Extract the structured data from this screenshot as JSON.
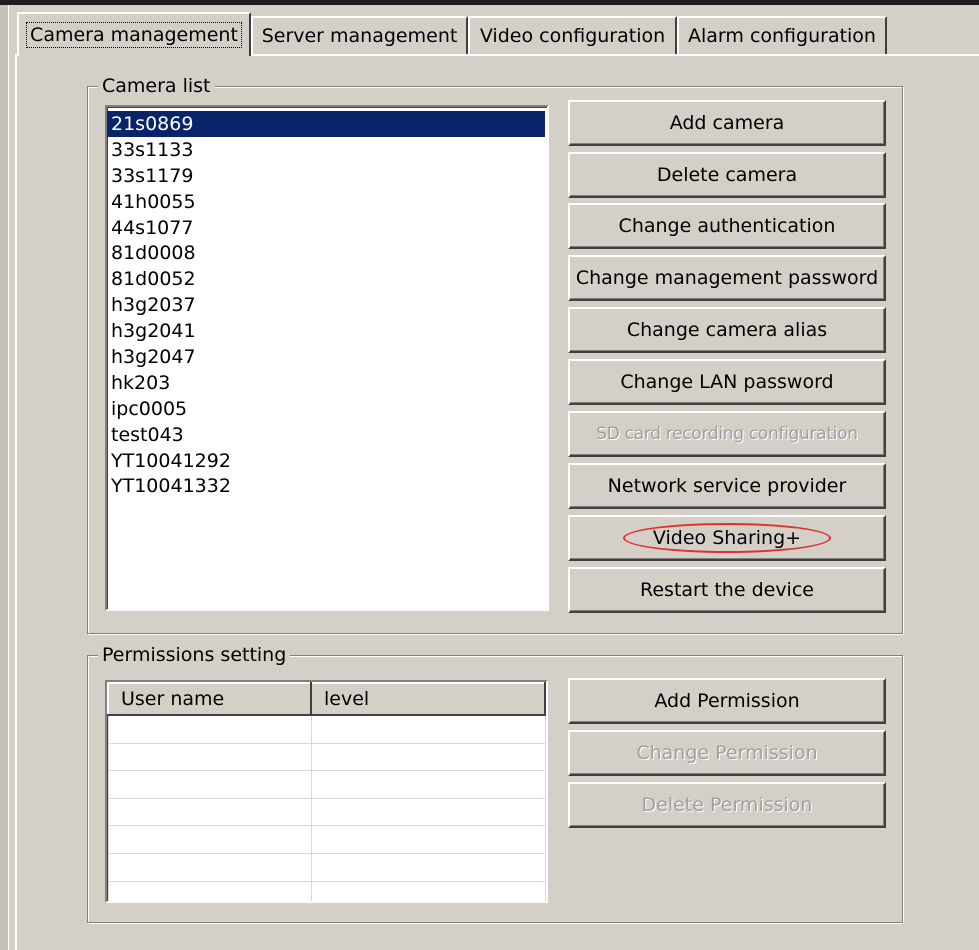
{
  "tabs": [
    {
      "label": "Camera management",
      "active": true
    },
    {
      "label": "Server management",
      "active": false
    },
    {
      "label": "Video configuration",
      "active": false
    },
    {
      "label": "Alarm configuration",
      "active": false
    }
  ],
  "camera_list": {
    "legend": "Camera list",
    "items": [
      "21s0869",
      "33s1133",
      "33s1179",
      "41h0055",
      "44s1077",
      "81d0008",
      "81d0052",
      "h3g2037",
      "h3g2041",
      "h3g2047",
      "hk203",
      "ipc0005",
      "test043",
      "YT10041292",
      "YT10041332"
    ],
    "selected": "21s0869"
  },
  "camera_buttons": [
    {
      "label": "Add camera",
      "enabled": true
    },
    {
      "label": "Delete camera",
      "enabled": true
    },
    {
      "label": "Change authentication",
      "enabled": true
    },
    {
      "label": "Change management password",
      "enabled": true
    },
    {
      "label": "Change camera alias",
      "enabled": true
    },
    {
      "label": "Change LAN password",
      "enabled": true
    },
    {
      "label": "SD card recording configuration",
      "enabled": false
    },
    {
      "label": "Network service provider",
      "enabled": true
    },
    {
      "label": "Video Sharing+",
      "enabled": true,
      "highlighted": true
    },
    {
      "label": "Restart the device",
      "enabled": true
    }
  ],
  "permissions": {
    "legend": "Permissions setting",
    "columns": [
      "User name",
      "level"
    ],
    "rows": []
  },
  "permission_buttons": [
    {
      "label": "Add Permission",
      "enabled": true
    },
    {
      "label": "Change Permission",
      "enabled": false
    },
    {
      "label": "Delete Permission",
      "enabled": false
    }
  ],
  "colors": {
    "window": "#d4d0c8",
    "selection": "#0a246a",
    "highlight_oval": "#e03030",
    "disabled_text": "#a0a0a0"
  }
}
